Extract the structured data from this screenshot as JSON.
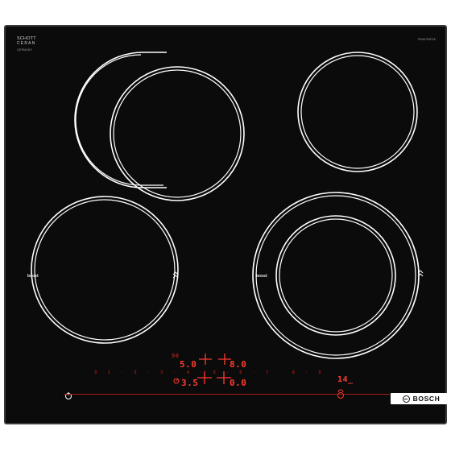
{
  "panel": {
    "maker_top": "SCHOTT",
    "maker_sub": "CERAN",
    "maker_tiny": "GERMANY",
    "model": "PKN675DP1E",
    "brand": "BOSCH"
  },
  "zones": {
    "front_left_boost": "boost",
    "front_right_boost": "boost"
  },
  "displays": {
    "front_left_level": "5.0",
    "back_left_level": "8.0",
    "timer_level": "3.5",
    "back_right_level": "0.0",
    "clock": "14",
    "clock_suffix": "_",
    "indicator_top": "90"
  },
  "slider": {
    "labels": [
      "0",
      "1",
      "·",
      "2",
      "·",
      "3",
      "·",
      "4",
      "·",
      "5",
      "·",
      "6",
      "·",
      "7",
      "·",
      "8",
      "·",
      "9"
    ]
  },
  "colors": {
    "glass": "#0b0b0b",
    "zone_line": "#ffffff",
    "display_red": "#ff3b2f",
    "dim_red": "#a31d16"
  }
}
